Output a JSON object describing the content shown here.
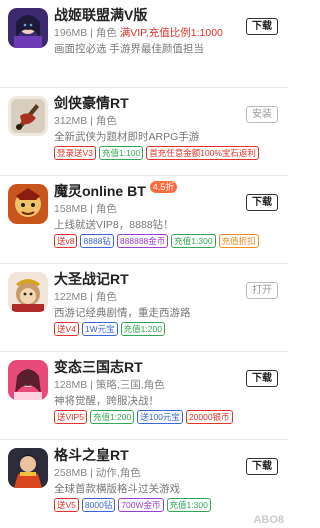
{
  "colors": {
    "accent": "#e4322b",
    "tag_red": "#e4322b",
    "tag_blue": "#3a66d8",
    "tag_green": "#33a852",
    "tag_purple": "#9b3fd1",
    "tag_orange": "#f08a1c"
  },
  "items": [
    {
      "name": "战姬联盟满V版",
      "badge": "",
      "size_cat": "196MB | 角色",
      "promo": "满VIP,充值比例1:1000",
      "desc": "画面控必选 手游界最佳颜值担当",
      "button": "下载",
      "icon": "anime-girl-icon",
      "tags": []
    },
    {
      "name": "剑侠豪情RT",
      "badge": "",
      "size_cat": "312MB | 角色",
      "promo": "",
      "desc": "全新武侠为题材即时ARPG手游",
      "button": "安装",
      "icon": "sword-logo-icon",
      "tags": [
        {
          "text": "登录送V3",
          "color": "#e4322b"
        },
        {
          "text": "充值1:100",
          "color": "#33a852"
        },
        {
          "text": "首充任意金额100%宝石返利",
          "color": "#e4322b"
        }
      ]
    },
    {
      "name": "魔灵online BT",
      "badge": "4.5折",
      "size_cat": "158MB | 角色",
      "promo": "",
      "desc": "上线就送VIP8，8888钻！",
      "button": "下载",
      "icon": "warrior-mask-icon",
      "tags": [
        {
          "text": "送v8",
          "color": "#e4322b"
        },
        {
          "text": "8888钻",
          "color": "#3a66d8"
        },
        {
          "text": "888888金币",
          "color": "#9b3fd1"
        },
        {
          "text": "充值1:300",
          "color": "#33a852"
        },
        {
          "text": "充值折扣",
          "color": "#f08a1c"
        }
      ]
    },
    {
      "name": "大圣战记RT",
      "badge": "",
      "size_cat": "122MB | 角色",
      "promo": "",
      "desc": "西游记经典剧情，重走西游路",
      "button": "打开",
      "icon": "monkey-king-icon",
      "tags": [
        {
          "text": "送V4",
          "color": "#e4322b"
        },
        {
          "text": "1W元宝",
          "color": "#3a66d8"
        },
        {
          "text": "充值1:200",
          "color": "#33a852"
        }
      ]
    },
    {
      "name": "变态三国志RT",
      "badge": "",
      "size_cat": "128MB | 策略,三国,角色",
      "promo": "",
      "desc": "神将觉醒，跨服决战！",
      "button": "下载",
      "icon": "three-kingdoms-girl-icon",
      "tags": [
        {
          "text": "送VIP5",
          "color": "#e4322b"
        },
        {
          "text": "充值1:200",
          "color": "#33a852"
        },
        {
          "text": "送100元宝",
          "color": "#3a66d8"
        },
        {
          "text": "20000银币",
          "color": "#e4322b"
        }
      ]
    },
    {
      "name": "格斗之皇RT",
      "badge": "",
      "size_cat": "258MB | 动作,角色",
      "promo": "",
      "desc": "全球首款横版格斗过关游戏",
      "button": "下载",
      "icon": "fighter-icon",
      "tags": [
        {
          "text": "送V5",
          "color": "#e4322b"
        },
        {
          "text": "8000钻",
          "color": "#3a66d8"
        },
        {
          "text": "700W金币",
          "color": "#9b3fd1"
        },
        {
          "text": "充值1:300",
          "color": "#33a852"
        }
      ]
    }
  ],
  "watermark": "ABO8"
}
